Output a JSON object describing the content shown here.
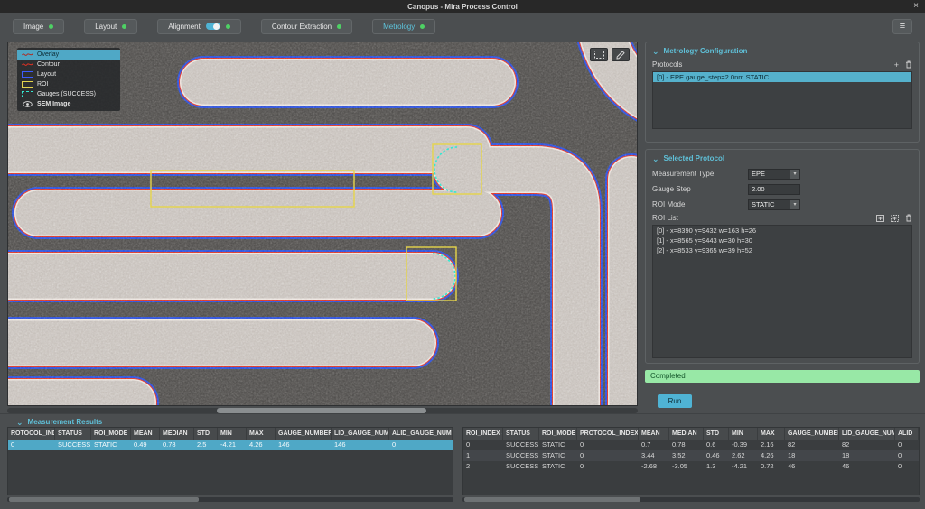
{
  "window": {
    "title": "Canopus - Mira Process Control"
  },
  "icons": {
    "close": "×",
    "menu": "≡",
    "dropdown": "▾",
    "plus": "+",
    "chevron": "⌄",
    "sort": "▴"
  },
  "toolbar": {
    "tabs": [
      {
        "label": "Image"
      },
      {
        "label": "Layout"
      },
      {
        "label": "Alignment"
      },
      {
        "label": "Contour Extraction"
      },
      {
        "label": "Metrology"
      }
    ]
  },
  "viewer": {
    "legend": {
      "selected_item": "Overlay",
      "items": [
        {
          "label": "Contour"
        },
        {
          "label": "Layout"
        },
        {
          "label": "ROI"
        },
        {
          "label": "Gauges (SUCCESS)"
        }
      ],
      "base_item": "SEM Image"
    }
  },
  "metrology_config": {
    "title": "Metrology Configuration",
    "protocols_label": "Protocols",
    "protocols": [
      "[0] - EPE  gauge_step=2.0nm  STATIC"
    ]
  },
  "selected_protocol": {
    "title": "Selected Protocol",
    "measurement_type_label": "Measurement Type",
    "measurement_type_value": "EPE",
    "gauge_step_label": "Gauge Step",
    "gauge_step_value": "2.00",
    "roi_mode_label": "ROI Mode",
    "roi_mode_value": "STATIC",
    "roi_list_label": "ROI List",
    "roi_items": [
      "[0] - x=8390 y=9432 w=163 h=26",
      "[1] - x=8565 y=9443 w=30 h=30",
      "[2] - x=8533 y=9365 w=39 h=52"
    ],
    "status_text": "Completed",
    "run_label": "Run"
  },
  "results": {
    "title": "Measurement Results",
    "protocol_table": {
      "headers": [
        "ROTOCOL_INDE",
        "STATUS",
        "ROI_MODE",
        "MEAN",
        "MEDIAN",
        "STD",
        "MIN",
        "MAX",
        "GAUGE_NUMBER",
        "LID_GAUGE_NUMI",
        "ALID_GAUGE_NUM"
      ],
      "rows": [
        [
          "0",
          "SUCCESS",
          "STATIC",
          "0.49",
          "0.78",
          "2.5",
          "-4.21",
          "4.26",
          "146",
          "146",
          "0"
        ]
      ]
    },
    "roi_table": {
      "headers": [
        "ROI_INDEX",
        "STATUS",
        "ROI_MODE",
        "PROTOCOL_INDEX",
        "MEAN",
        "MEDIAN",
        "STD",
        "MIN",
        "MAX",
        "GAUGE_NUMBER",
        "LID_GAUGE_NUMB",
        "ALID"
      ],
      "rows": [
        [
          "0",
          "SUCCESS",
          "STATIC",
          "0",
          "0.7",
          "0.78",
          "0.6",
          "-0.39",
          "2.16",
          "82",
          "82",
          "0"
        ],
        [
          "1",
          "SUCCESS",
          "STATIC",
          "0",
          "3.44",
          "3.52",
          "0.46",
          "2.62",
          "4.26",
          "18",
          "18",
          "0"
        ],
        [
          "2",
          "SUCCESS",
          "STATIC",
          "0",
          "-2.68",
          "-3.05",
          "1.3",
          "-4.21",
          "0.72",
          "46",
          "46",
          "0"
        ]
      ]
    }
  }
}
